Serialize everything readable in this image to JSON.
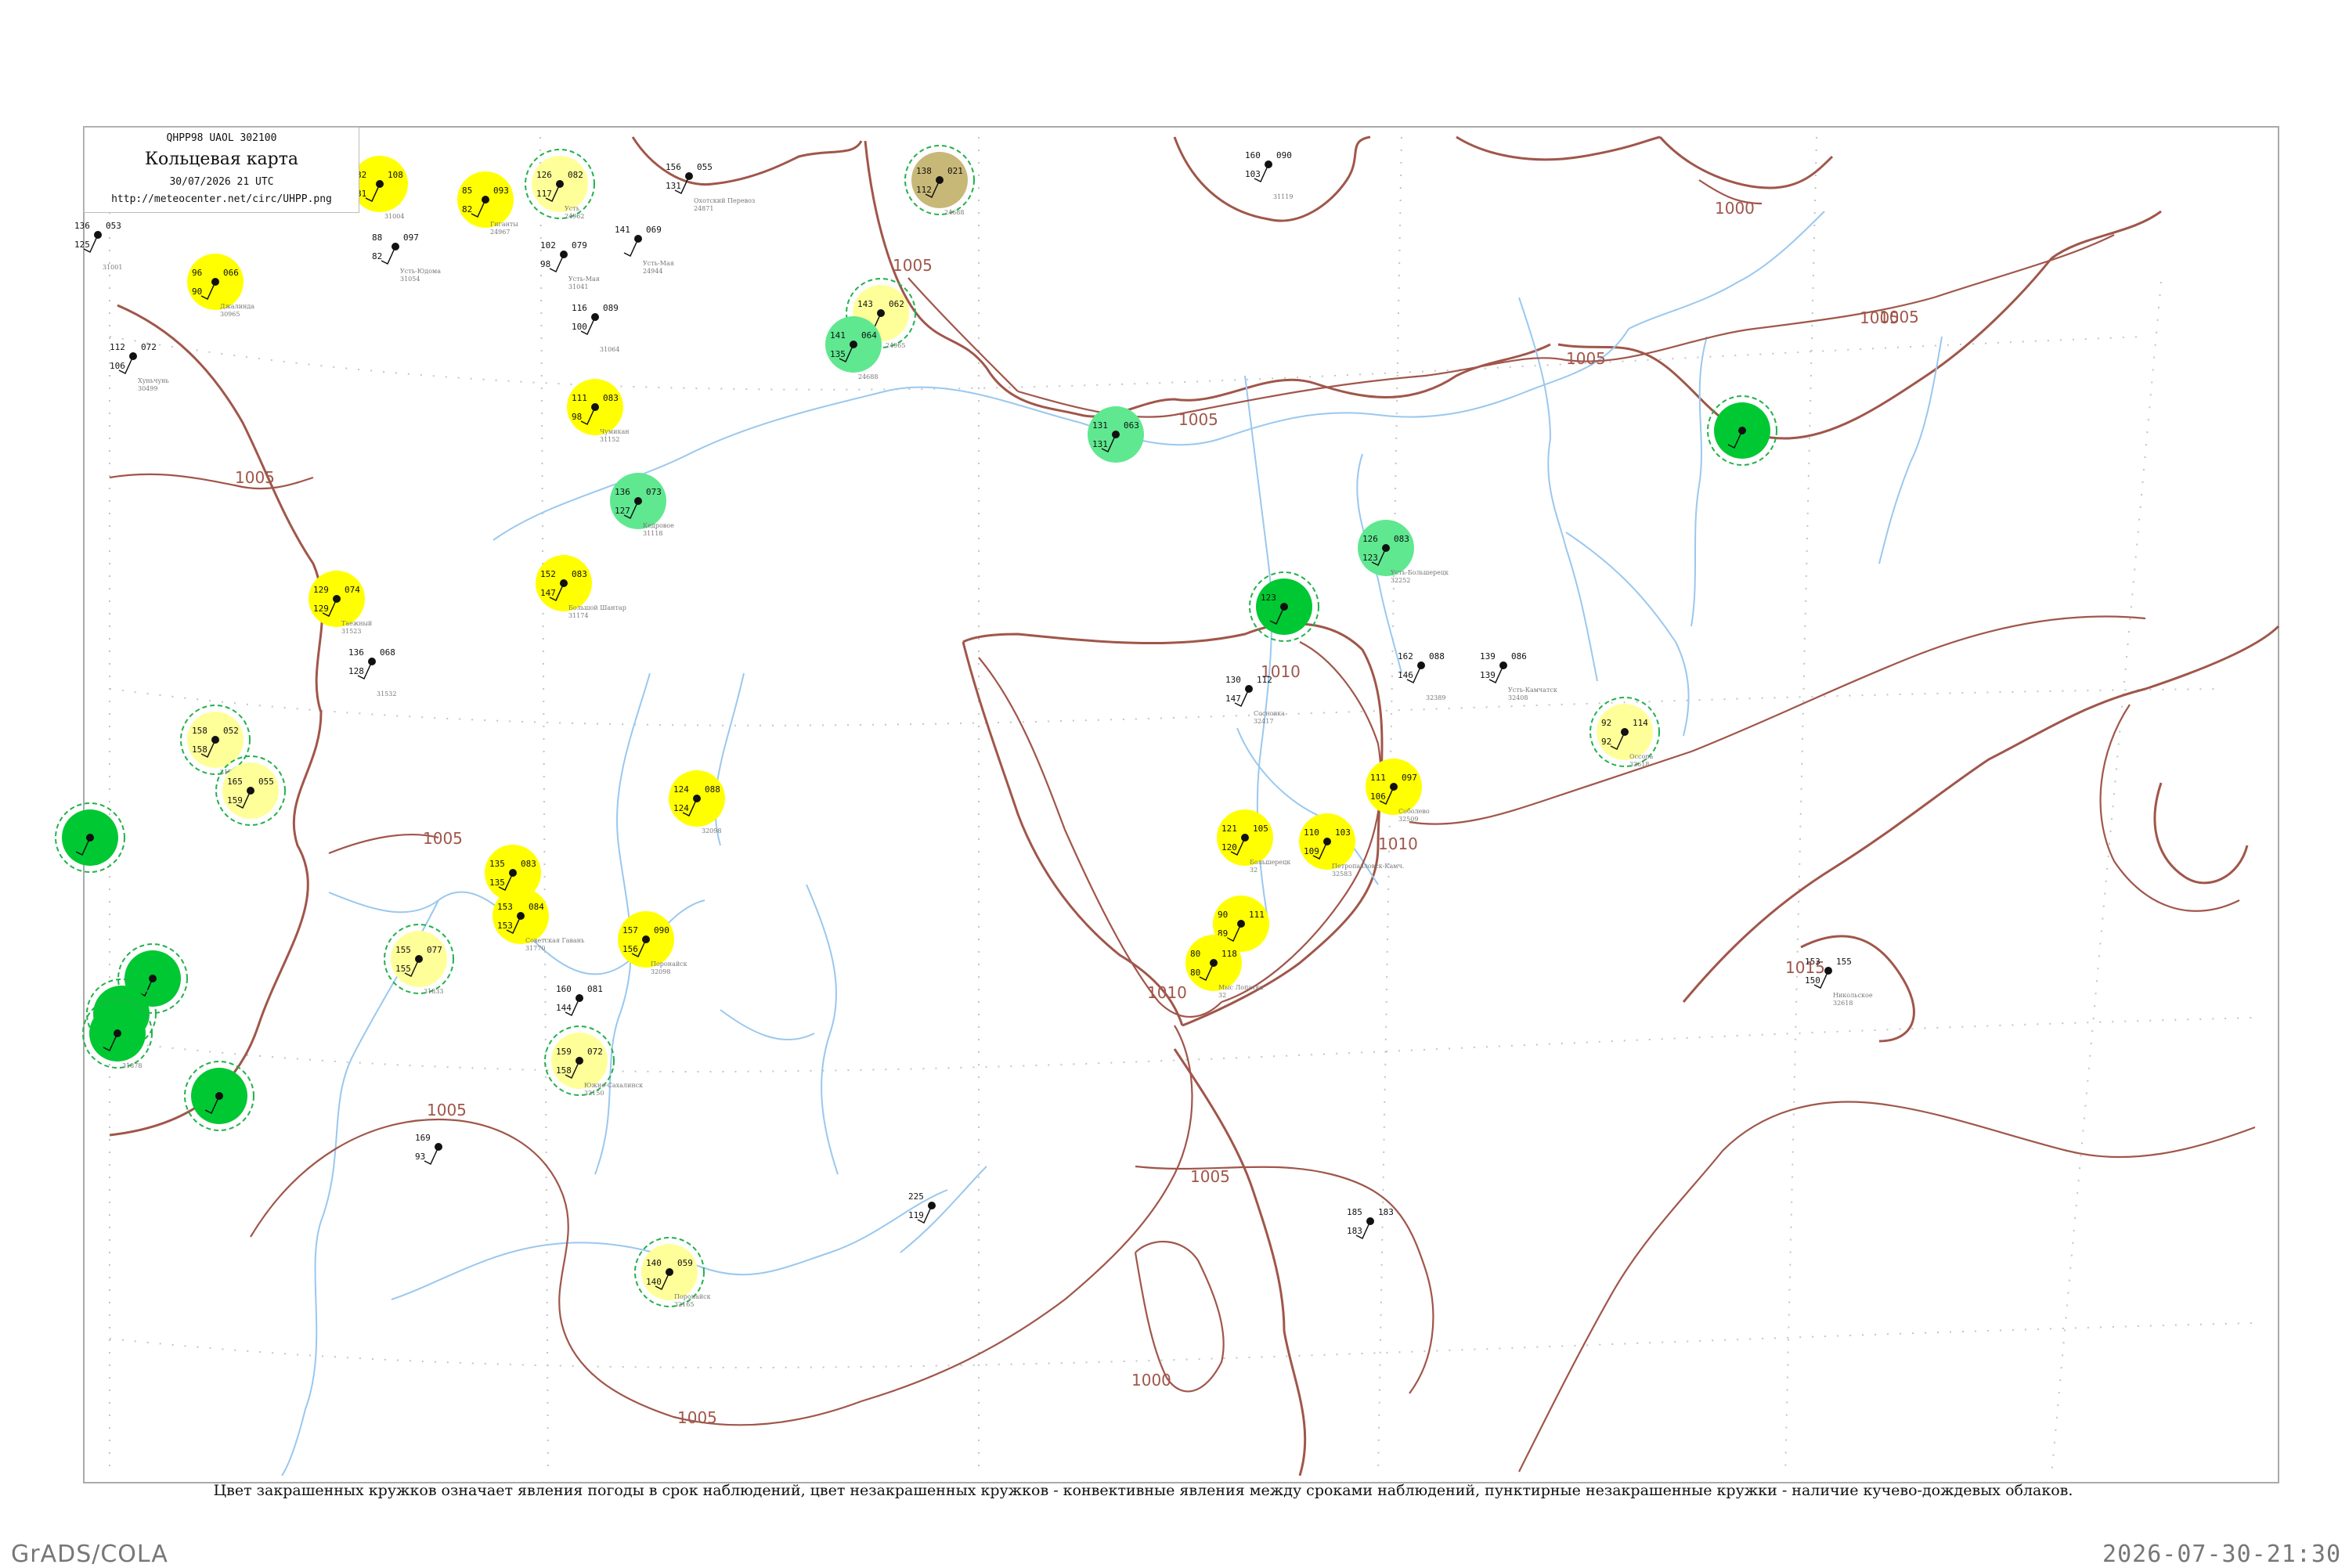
{
  "header": {
    "code": "QHPP98  UAOL  302100",
    "title": "Кольцевая карта",
    "date": "30/07/2026 21 UTC",
    "url": "http://meteocenter.net/circ/UHPP.png"
  },
  "caption": "Цвет закрашенных кружков означает явления погоды в срок наблюдений, цвет незакрашенных кружков - конвективные явления между сроками наблюдений, пунктирные незакрашенные кружки - наличие кучево-дождевых облаков.",
  "footer": {
    "left": "GrADS/COLA",
    "right": "2026-07-30-21:30"
  },
  "colors": {
    "isobar": "#a0564a",
    "river": "#9ac8ee",
    "grid": "#bbbbbb",
    "yellow": "#ffff00",
    "light_yellow": "#ffff99",
    "green": "#00c832",
    "light_green": "#5fe890",
    "khaki": "#c8b878",
    "dash_ring": "#22b14c"
  },
  "isobar_labels": [
    {
      "id": "iso-1",
      "text": "1005"
    },
    {
      "id": "iso-2",
      "text": "1005"
    },
    {
      "id": "iso-3",
      "text": "1005"
    },
    {
      "id": "iso-4",
      "text": "1005"
    },
    {
      "id": "iso-5",
      "text": "1005"
    },
    {
      "id": "iso-6",
      "text": "1005"
    },
    {
      "id": "iso-7",
      "text": "1010"
    },
    {
      "id": "iso-8",
      "text": "1010"
    },
    {
      "id": "iso-9",
      "text": "1010"
    },
    {
      "id": "iso-10",
      "text": "1015"
    },
    {
      "id": "iso-11",
      "text": "1005"
    },
    {
      "id": "iso-12",
      "text": "1005"
    },
    {
      "id": "iso-13",
      "text": "1000"
    },
    {
      "id": "iso-14",
      "text": "1005"
    },
    {
      "id": "iso-15",
      "text": "1000"
    },
    {
      "id": "iso-16",
      "text": "1005"
    }
  ],
  "stations": [
    {
      "name": "",
      "id": "31004",
      "fill": "yellow",
      "t": "82",
      "p": "108",
      "d": "81"
    },
    {
      "name": "Гиганты",
      "id": "24967",
      "fill": "yellow",
      "t": "85",
      "p": "093",
      "d": "82"
    },
    {
      "name": "Усть",
      "id": "24962",
      "fill": "light_yellow",
      "t": "126",
      "p": "082",
      "d": "117"
    },
    {
      "name": "Охотский Перевоз",
      "id": "24871",
      "fill": "",
      "t": "156",
      "p": "055",
      "d": "131"
    },
    {
      "name": "",
      "id": "24688",
      "fill": "khaki",
      "t": "138",
      "p": "021",
      "d": "112"
    },
    {
      "name": "",
      "id": "31001",
      "fill": "",
      "t": "136",
      "p": "053",
      "d": "125"
    },
    {
      "name": "Джалинда",
      "id": "30965",
      "fill": "yellow",
      "t": "96",
      "p": "066",
      "d": "90"
    },
    {
      "name": "Усть-Мая",
      "id": "24944",
      "fill": "",
      "t": "141",
      "p": "069",
      "d": ""
    },
    {
      "name": "Усть-Мая",
      "id": "31041",
      "fill": "",
      "t": "102",
      "p": "079",
      "d": "98"
    },
    {
      "name": "",
      "id": "31064",
      "fill": "",
      "t": "116",
      "p": "089",
      "d": "100"
    },
    {
      "name": "Усть-Юдома",
      "id": "31054",
      "fill": "",
      "t": "88",
      "p": "097",
      "d": "82"
    },
    {
      "name": "Хуньчунь",
      "id": "30499",
      "fill": "",
      "t": "112",
      "p": "072",
      "d": "106"
    },
    {
      "name": "",
      "id": "24965",
      "fill": "light_yellow",
      "t": "143",
      "p": "062",
      "d": ""
    },
    {
      "name": "",
      "id": "24688",
      "fill": "light_green",
      "t": "141",
      "p": "064",
      "d": "135"
    },
    {
      "name": "Чумикан",
      "id": "31152",
      "fill": "yellow",
      "t": "111",
      "p": "083",
      "d": "98"
    },
    {
      "name": "",
      "id": "",
      "fill": "light_green",
      "t": "131",
      "p": "063",
      "d": "131"
    },
    {
      "name": "",
      "id": "31119",
      "fill": "",
      "t": "160",
      "p": "090",
      "d": "103"
    },
    {
      "name": "Кедровое",
      "id": "31118",
      "fill": "light_green",
      "t": "136",
      "p": "073",
      "d": "127"
    },
    {
      "name": "Большой Шантар",
      "id": "31174",
      "fill": "yellow",
      "t": "152",
      "p": "083",
      "d": "147"
    },
    {
      "name": "Усть-Большерецк",
      "id": "32252",
      "fill": "light_green",
      "t": "126",
      "p": "083",
      "d": "123"
    },
    {
      "name": "",
      "id": "",
      "fill": "green",
      "t": "123",
      "p": "",
      "d": ""
    },
    {
      "name": "",
      "id": "",
      "fill": "green",
      "t": "",
      "p": "",
      "d": ""
    },
    {
      "name": "Таежный",
      "id": "31523",
      "fill": "yellow",
      "t": "129",
      "p": "074",
      "d": "129"
    },
    {
      "name": "",
      "id": "31532",
      "fill": "",
      "t": "136",
      "p": "068",
      "d": "128"
    },
    {
      "name": "",
      "id": "32389",
      "fill": "",
      "t": "162",
      "p": "088",
      "d": "146"
    },
    {
      "name": "Усть-Камчатск",
      "id": "32408",
      "fill": "",
      "t": "139",
      "p": "086",
      "d": "139"
    },
    {
      "name": "Сосновка",
      "id": "32417",
      "fill": "",
      "t": "130",
      "p": "112",
      "d": "147"
    },
    {
      "name": "Оссора",
      "id": "32618",
      "fill": "light_yellow",
      "t": "92",
      "p": "114",
      "d": "92"
    },
    {
      "name": "Соболево",
      "id": "32509",
      "fill": "yellow",
      "t": "111",
      "p": "097",
      "d": "106"
    },
    {
      "name": "Петропавловск-Камч.",
      "id": "32583",
      "fill": "yellow",
      "t": "110",
      "p": "103",
      "d": "109"
    },
    {
      "name": "Большерецк",
      "id": "32",
      "fill": "yellow",
      "t": "121",
      "p": "105",
      "d": "120"
    },
    {
      "name": "",
      "id": "",
      "fill": "yellow",
      "t": "90",
      "p": "111",
      "d": "89"
    },
    {
      "name": "Мыс Лопатка",
      "id": "32",
      "fill": "yellow",
      "t": "80",
      "p": "118",
      "d": "80"
    },
    {
      "name": "Никольское",
      "id": "32618",
      "fill": "",
      "t": "153",
      "p": "155",
      "d": "150"
    },
    {
      "name": "",
      "id": "31735",
      "fill": "light_yellow",
      "t": "158",
      "p": "052",
      "d": "158"
    },
    {
      "name": "",
      "id": "",
      "fill": "light_yellow",
      "t": "165",
      "p": "055",
      "d": "159"
    },
    {
      "name": "",
      "id": "31770",
      "fill": "yellow",
      "t": "135",
      "p": "083",
      "d": "135"
    },
    {
      "name": "Советская Гавань",
      "id": "31770",
      "fill": "yellow",
      "t": "153",
      "p": "084",
      "d": "153"
    },
    {
      "name": "",
      "id": "32098",
      "fill": "yellow",
      "t": "124",
      "p": "088",
      "d": "124"
    },
    {
      "name": "Поронайск",
      "id": "32098",
      "fill": "yellow",
      "t": "157",
      "p": "090",
      "d": "156"
    },
    {
      "name": "",
      "id": "31833",
      "fill": "light_yellow",
      "t": "155",
      "p": "077",
      "d": "155"
    },
    {
      "name": "Южно-Сахалинск",
      "id": "32150",
      "fill": "light_yellow",
      "t": "159",
      "p": "072",
      "d": "158"
    },
    {
      "name": "",
      "id": "",
      "fill": "green",
      "t": "",
      "p": "",
      "d": ""
    },
    {
      "name": "",
      "id": "",
      "fill": "green",
      "t": "",
      "p": "",
      "d": ""
    },
    {
      "name": "",
      "id": "31878",
      "fill": "green",
      "t": "",
      "p": "",
      "d": ""
    },
    {
      "name": "",
      "id": "",
      "fill": "green",
      "t": "",
      "p": "",
      "d": ""
    },
    {
      "name": "",
      "id": "",
      "fill": "green",
      "t": "",
      "p": "",
      "d": ""
    },
    {
      "name": "Поронайск",
      "id": "32165",
      "fill": "light_yellow",
      "t": "140",
      "p": "059",
      "d": "140"
    },
    {
      "name": "",
      "id": "",
      "fill": "",
      "t": "160",
      "p": "081",
      "d": "144"
    },
    {
      "name": "",
      "id": "",
      "fill": "",
      "t": "225",
      "p": "",
      "d": "119"
    },
    {
      "name": "",
      "id": "",
      "fill": "",
      "t": "185",
      "p": "183",
      "d": "183"
    },
    {
      "name": "",
      "id": "",
      "fill": "",
      "t": "169",
      "p": "",
      "d": "93"
    }
  ]
}
